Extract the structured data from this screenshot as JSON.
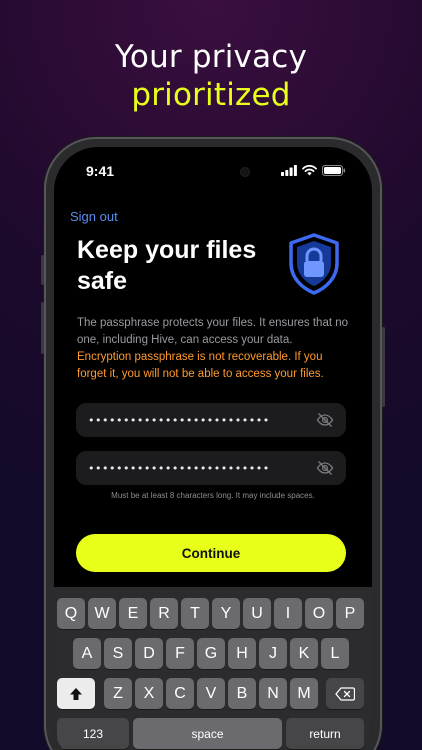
{
  "hero": {
    "line1": "Your privacy",
    "line2": "prioritized",
    "line2_color": "#e8ff1a"
  },
  "status_bar": {
    "time": "9:41"
  },
  "screen": {
    "sign_out": "Sign out",
    "title": "Keep your files safe",
    "description": "The passphrase protects your files. It ensures that no one, including Hive, can access your data.",
    "warning": "Encryption passphrase is not recoverable. If you forget it, you will not be able to access your files.",
    "warning_color": "#ff9a2e",
    "passphrase_value": "••••••••••••••••••••••••••",
    "confirm_value": "••••••••••••••••••••••••••",
    "hint": "Must be at least 8 characters long. It may include spaces.",
    "continue_label": "Continue",
    "accent_color": "#e8ff1a",
    "link_color": "#5b8cf0"
  },
  "keyboard": {
    "row1": [
      "Q",
      "W",
      "E",
      "R",
      "T",
      "Y",
      "U",
      "I",
      "O",
      "P"
    ],
    "row2": [
      "A",
      "S",
      "D",
      "F",
      "G",
      "H",
      "J",
      "K",
      "L"
    ],
    "row3": [
      "Z",
      "X",
      "C",
      "V",
      "B",
      "N",
      "M"
    ],
    "numbers_label": "123",
    "space_label": "space",
    "return_label": "return"
  }
}
